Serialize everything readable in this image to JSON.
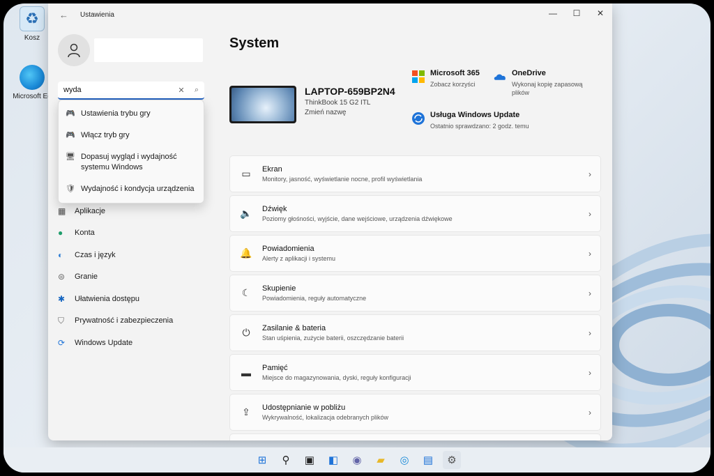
{
  "desktop": {
    "recycle_label": "Kosz",
    "edge_label": "Microsoft Ed"
  },
  "window": {
    "title": "Ustawienia",
    "back_icon": "back-arrow-icon",
    "controls": [
      "—",
      "☐",
      "✕"
    ]
  },
  "search": {
    "value": "wyda",
    "clear_icon": "✕",
    "search_icon": "⌕"
  },
  "search_results": [
    {
      "label": "Ustawienia trybu gry",
      "icon": "gamepad-icon",
      "glyph": "🎮"
    },
    {
      "label": "Włącz tryb gry",
      "icon": "gamepad-icon",
      "glyph": "🎮"
    },
    {
      "label": "Dopasuj wygląd i wydajność systemu Windows",
      "icon": "performance-icon",
      "glyph": "🖥"
    },
    {
      "label": "Wydajność i kondycja urządzenia",
      "icon": "shield-icon",
      "glyph": "🛡"
    }
  ],
  "nav": [
    {
      "label": "Aplikacje",
      "icon": "apps-icon",
      "glyph": "▦",
      "color": "#4a4a4a"
    },
    {
      "label": "Konta",
      "icon": "accounts-icon",
      "glyph": "●",
      "color": "#1f9d6b"
    },
    {
      "label": "Czas i język",
      "icon": "globe-icon",
      "glyph": "◐",
      "color": "#2b7bd3"
    },
    {
      "label": "Granie",
      "icon": "gamepad-icon",
      "glyph": "⊜",
      "color": "#666"
    },
    {
      "label": "Ułatwienia dostępu",
      "icon": "accessibility-icon",
      "glyph": "✱",
      "color": "#1565c0"
    },
    {
      "label": "Prywatność i zabezpieczenia",
      "icon": "shield-icon",
      "glyph": "⛉",
      "color": "#666"
    },
    {
      "label": "Windows Update",
      "icon": "update-icon",
      "glyph": "⟳",
      "color": "#1e73d8"
    }
  ],
  "page": {
    "title": "System"
  },
  "device": {
    "name": "LAPTOP-659BP2N4",
    "model": "ThinkBook 15 G2 ITL",
    "rename": "Zmień nazwę"
  },
  "services": {
    "m365": {
      "name": "Microsoft 365",
      "sub": "Zobacz korzyści"
    },
    "onedrive": {
      "name": "OneDrive",
      "sub": "Wykonaj kopię zapasową plików"
    },
    "update": {
      "name": "Usługa Windows Update",
      "sub": "Ostatnio sprawdzano: 2 godz. temu"
    }
  },
  "rows": [
    {
      "title": "Ekran",
      "sub": "Monitory, jasność, wyświetlanie nocne, profil wyświetlania",
      "icon": "monitor-icon",
      "glyph": "▭"
    },
    {
      "title": "Dźwięk",
      "sub": "Poziomy głośności, wyjście, dane wejściowe, urządzenia dźwiękowe",
      "icon": "speaker-icon",
      "glyph": "🔈"
    },
    {
      "title": "Powiadomienia",
      "sub": "Alerty z aplikacji i systemu",
      "icon": "bell-icon",
      "glyph": "🔔"
    },
    {
      "title": "Skupienie",
      "sub": "Powiadomienia, reguły automatyczne",
      "icon": "moon-icon",
      "glyph": "☾"
    },
    {
      "title": "Zasilanie & bateria",
      "sub": "Stan uśpienia, zużycie baterii, oszczędzanie baterii",
      "icon": "power-icon",
      "glyph": "⏻"
    },
    {
      "title": "Pamięć",
      "sub": "Miejsce do magazynowania, dyski, reguły konfiguracji",
      "icon": "storage-icon",
      "glyph": "▬"
    },
    {
      "title": "Udostępnianie w pobliżu",
      "sub": "Wykrywalność, lokalizacja odebranych plików",
      "icon": "share-icon",
      "glyph": "⇪"
    }
  ],
  "chevron": "›",
  "taskbar": [
    {
      "name": "start-icon",
      "glyph": "⊞",
      "color": "#1e73d8"
    },
    {
      "name": "search-icon",
      "glyph": "⚲",
      "color": "#222"
    },
    {
      "name": "task-view-icon",
      "glyph": "▣",
      "color": "#222"
    },
    {
      "name": "widgets-icon",
      "glyph": "◧",
      "color": "#1e73d8"
    },
    {
      "name": "teams-chat-icon",
      "glyph": "◉",
      "color": "#6264a7"
    },
    {
      "name": "file-explorer-icon",
      "glyph": "▰",
      "color": "#e8b828"
    },
    {
      "name": "edge-icon",
      "glyph": "◎",
      "color": "#1a8ad8"
    },
    {
      "name": "store-icon",
      "glyph": "▤",
      "color": "#1e73d8"
    },
    {
      "name": "settings-icon",
      "glyph": "⚙",
      "color": "#555"
    }
  ]
}
